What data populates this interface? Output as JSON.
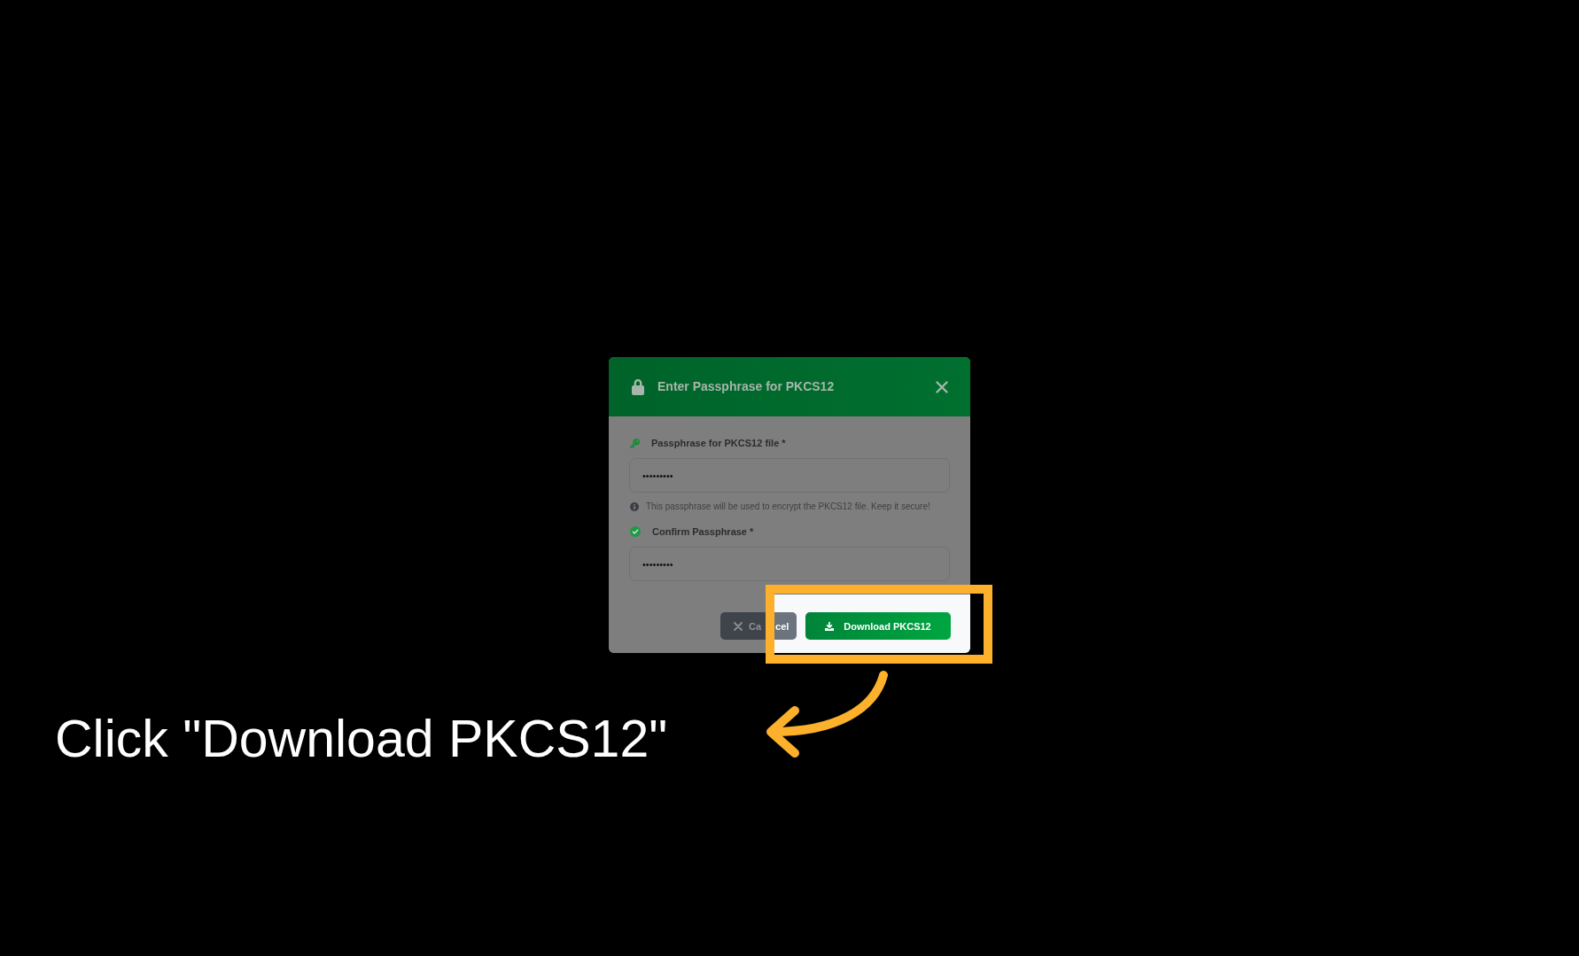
{
  "dialog": {
    "title": "Enter Passphrase for PKCS12",
    "fields": [
      {
        "kind": "passphrase",
        "label": "Passphrase for PKCS12 file *",
        "value": "•••••••••",
        "hint": "This passphrase will be used to encrypt the PKCS12 file. Keep it secure!"
      },
      {
        "kind": "confirm",
        "label": "Confirm Passphrase *",
        "value": "•••••••••"
      }
    ],
    "buttons": [
      {
        "kind": "cancel",
        "label_parts": [
          "Ca",
          "cel"
        ]
      },
      {
        "kind": "download",
        "label": "Download PKCS12"
      }
    ]
  },
  "caption": "Click \"Download PKCS12\""
}
